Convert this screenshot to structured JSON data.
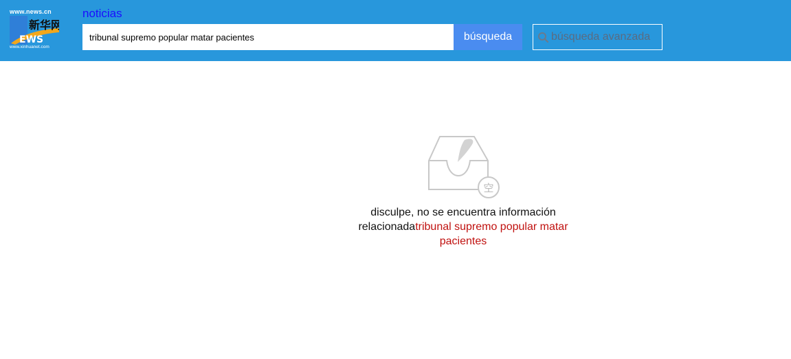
{
  "logo": {
    "top_text": "www.news.cn",
    "chinese_text": "新华网",
    "news_text": "EWS",
    "bottom_text": "www.xinhuanet.com"
  },
  "header": {
    "nav_link": "noticias",
    "search_value": "tribunal supremo popular matar pacientes",
    "search_button": "búsqueda",
    "advanced_button": "búsqueda avanzada"
  },
  "empty_state": {
    "icon": "empty-inbox-icon",
    "badge_char": "空",
    "message_line1": "disculpe, no se encuentra información",
    "message_prefix": "relacionada",
    "query": "tribunal supremo popular matar pacientes"
  },
  "colors": {
    "header_bg": "#2897dc",
    "search_button_bg": "#4a8cf0",
    "nav_link": "#1a0dff",
    "query_text": "#c0110f"
  }
}
